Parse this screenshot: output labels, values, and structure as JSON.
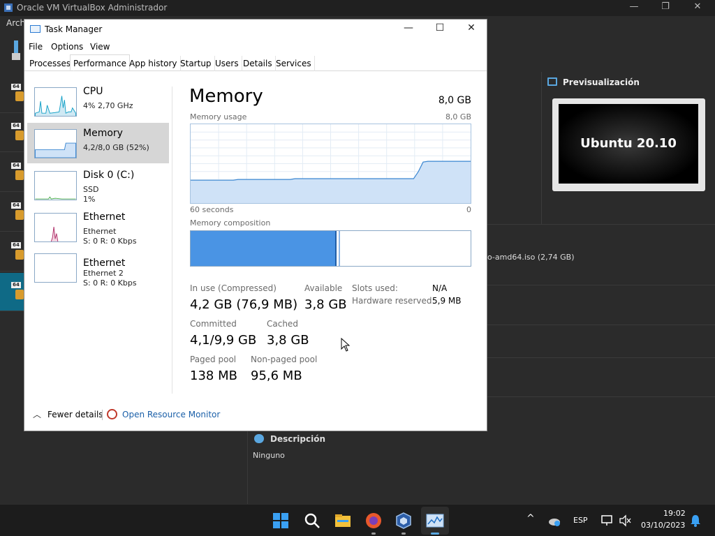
{
  "vbox": {
    "title": "Oracle VM VirtualBox Administrador",
    "menu_file": "Archi",
    "preview_title": "Previsualización",
    "preview_screen_text": "Ubuntu 20.10",
    "storage_text": "o-amd64.iso (2,74 GB)",
    "description_title": "Descripción",
    "description_value": "Ninguno",
    "vm_badge": "64",
    "window_controls": [
      "—",
      "❐",
      "✕"
    ]
  },
  "task_manager": {
    "title": "Task Manager",
    "menu": [
      "File",
      "Options",
      "View"
    ],
    "tabs": [
      "Processes",
      "Performance",
      "App history",
      "Startup",
      "Users",
      "Details",
      "Services"
    ],
    "active_tab": "Performance",
    "sidebar": [
      {
        "name": "CPU",
        "line1": "4% 2,70 GHz",
        "line2": ""
      },
      {
        "name": "Memory",
        "line1": "4,2/8,0 GB (52%)",
        "line2": ""
      },
      {
        "name": "Disk 0 (C:)",
        "line1": "SSD",
        "line2": "1%"
      },
      {
        "name": "Ethernet",
        "line1": "Ethernet",
        "line2": "S: 0 R: 0 Kbps"
      },
      {
        "name": "Ethernet",
        "line1": "Ethernet 2",
        "line2": "S: 0 R: 0 Kbps"
      }
    ],
    "memory": {
      "heading": "Memory",
      "total": "8,0 GB",
      "usage_label": "Memory usage",
      "usage_max": "8,0 GB",
      "time_label": "60 seconds",
      "time_end": "0",
      "composition_label": "Memory composition",
      "stats": {
        "in_use_label": "In use (Compressed)",
        "in_use_value": "4,2 GB (76,9 MB)",
        "available_label": "Available",
        "available_value": "3,8 GB",
        "committed_label": "Committed",
        "committed_value": "4,1/9,9 GB",
        "cached_label": "Cached",
        "cached_value": "3,8 GB",
        "paged_label": "Paged pool",
        "paged_value": "138 MB",
        "nonpaged_label": "Non-paged pool",
        "nonpaged_value": "95,6 MB",
        "slots_label": "Slots used:",
        "slots_value": "N/A",
        "hw_label": "Hardware reserved:",
        "hw_value": "5,9 MB"
      },
      "usage_percent": 52,
      "history_percent": [
        29,
        29,
        29,
        29,
        29,
        29,
        29,
        29,
        29,
        29,
        30,
        30,
        30,
        30,
        30,
        30,
        30,
        30,
        30,
        30,
        30,
        30,
        31,
        31,
        31,
        31,
        31,
        31,
        31,
        31,
        31,
        31,
        31,
        31,
        31,
        31,
        31,
        31,
        31,
        31,
        31,
        31,
        31,
        31,
        31,
        31,
        31,
        31,
        40,
        52,
        53,
        53,
        53,
        53,
        53,
        53,
        53,
        53,
        53,
        53
      ]
    },
    "footer": {
      "fewer_details": "Fewer details",
      "open_resource_monitor": "Open Resource Monitor"
    },
    "colors": {
      "memory_fill": "#cfe2f7",
      "memory_line": "#3a86d1",
      "composition_used": "#4a94e4"
    }
  },
  "taskbar": {
    "language": "ESP",
    "time": "19:02",
    "date": "03/10/2023",
    "icons": [
      "windows-start-icon",
      "search-icon",
      "file-explorer-icon",
      "firefox-icon",
      "virtualbox-icon",
      "task-manager-icon"
    ]
  }
}
